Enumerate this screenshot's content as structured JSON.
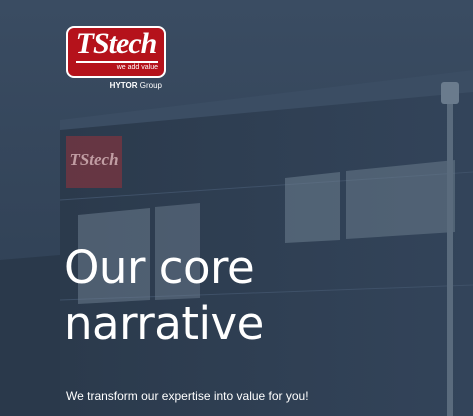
{
  "logo": {
    "brand": "TStech",
    "tagline": "we add value",
    "group_name": "HYTOR",
    "group_suffix": "Group"
  },
  "building_sign": "TStech",
  "hero": {
    "headline_line1": "Our core",
    "headline_line2": "narrative",
    "subheadline": "We transform our expertise into value for you!"
  },
  "colors": {
    "overlay": "#2e3e52",
    "logo_red": "#b5121b",
    "text": "#ffffff"
  }
}
